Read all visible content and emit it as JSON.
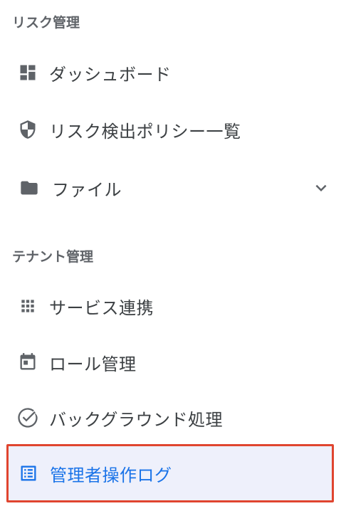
{
  "sections": {
    "risk": {
      "title": "リスク管理",
      "items": [
        {
          "label": "ダッシュボード",
          "icon": "dashboard-icon"
        },
        {
          "label": "リスク検出ポリシー一覧",
          "icon": "shield-icon"
        },
        {
          "label": "ファイル",
          "icon": "folder-icon",
          "expand_icon": "chevron-down-icon"
        }
      ]
    },
    "tenant": {
      "title": "テナント管理",
      "items": [
        {
          "label": "サービス連携",
          "icon": "apps-grid-icon"
        },
        {
          "label": "ロール管理",
          "icon": "calendar-icon"
        },
        {
          "label": "バックグラウンド処理",
          "icon": "check-circle-icon"
        },
        {
          "label": "管理者操作ログ",
          "icon": "list-icon",
          "active": true
        }
      ]
    }
  },
  "colors": {
    "active_text": "#1a73e8",
    "active_background": "#eef0fb",
    "highlight_border": "#e0452f",
    "icon": "#5f6368"
  }
}
